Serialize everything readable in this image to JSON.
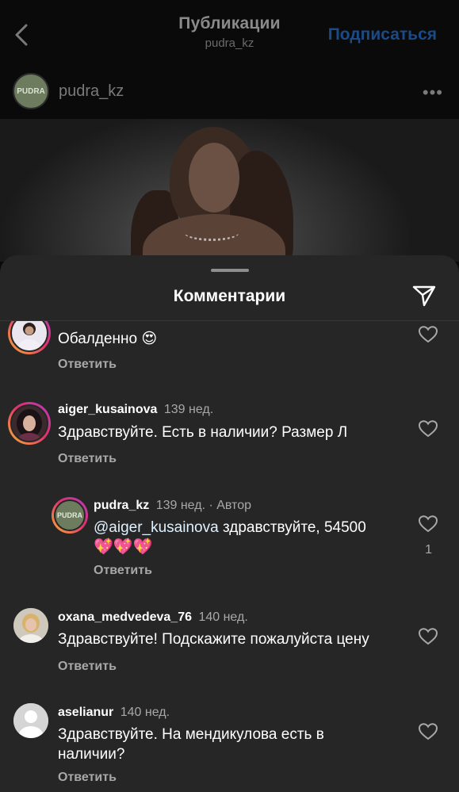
{
  "header": {
    "title": "Публикации",
    "subtitle": "pudra_kz",
    "follow_label": "Подписаться"
  },
  "post": {
    "username": "pudra_kz",
    "avatar_text": "PUDRA",
    "more_label": "•••"
  },
  "comments_sheet": {
    "title": "Комментарии",
    "comments": [
      {
        "username": "",
        "meta": "",
        "text": "Обалденно 😍",
        "reply_label": "Ответить",
        "likes": ""
      },
      {
        "username": "aiger_kusainova",
        "meta": "139 нед.",
        "text": "Здравствуйте. Есть в наличии? Размер Л",
        "reply_label": "Ответить",
        "likes": ""
      },
      {
        "username": "pudra_kz",
        "meta": "139 нед. · Автор",
        "mention": "@aiger_kusainova",
        "text": " здравствуйте, 54500",
        "text_line2": "💖💖💖",
        "reply_label": "Ответить",
        "likes": "1",
        "avatar_text": "PUDRA"
      },
      {
        "username": "oxana_medvedeva_76",
        "meta": "140 нед.",
        "text": "Здравствуйте! Подскажите пожалуйста цену",
        "reply_label": "Ответить",
        "likes": ""
      },
      {
        "username": "aselianur",
        "meta": "140 нед.",
        "text": "Здравствуйте. На мендикулова есть в",
        "text_line2": "наличии?",
        "reply_label": "Ответить",
        "likes": ""
      }
    ]
  },
  "colors": {
    "sheet_bg": "#262626",
    "follow_blue": "#1b4b86",
    "secondary_text": "#a8a8a8",
    "story_ring": "#e1306c"
  },
  "icons": [
    "back-chevron-icon",
    "more-dots-icon",
    "share-send-icon",
    "heart-icon",
    "default-avatar-icon"
  ]
}
